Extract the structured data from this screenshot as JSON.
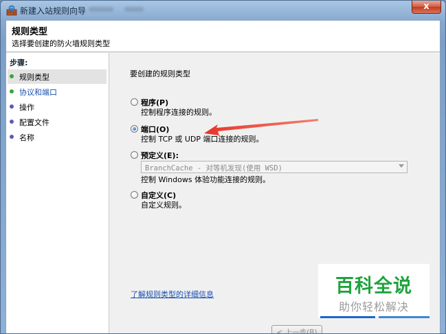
{
  "window": {
    "title": "新建入站规则向导",
    "close_symbol": "x"
  },
  "header": {
    "title": "规则类型",
    "subtitle": "选择要创建的防火墙规则类型"
  },
  "sidebar": {
    "steps_label": "步骤:",
    "steps": [
      {
        "label": "规则类型",
        "color": "#3aa53a",
        "current": true
      },
      {
        "label": "协议和端口",
        "color": "#3aa53a",
        "current": false
      },
      {
        "label": "操作",
        "color": "#5a5ab8",
        "current": false
      },
      {
        "label": "配置文件",
        "color": "#5a5ab8",
        "current": false
      },
      {
        "label": "名称",
        "color": "#5a5ab8",
        "current": false
      }
    ]
  },
  "main": {
    "prompt": "要创建的规则类型",
    "options": [
      {
        "label": "程序(P)",
        "description": "控制程序连接的规则。",
        "checked": false
      },
      {
        "label": "端口(O)",
        "description": "控制 TCP 或 UDP 端口连接的规则。",
        "checked": true
      },
      {
        "label": "预定义(E):",
        "description": "控制 Windows 体验功能连接的规则。",
        "checked": false
      },
      {
        "label": "自定义(C)",
        "description": "自定义规则。",
        "checked": false
      }
    ],
    "preset_value": "BranchCache - 对等机发现(使用 WSD)",
    "learn_more_link": "了解规则类型的详细信息"
  },
  "footer": {
    "back_label": "< 上一步(B)"
  },
  "watermark": {
    "logo": "百科全说",
    "tagline": "助你轻松解决"
  },
  "colors": {
    "arrow": "#e8352a",
    "link": "#1a4fb0",
    "watermark_green": "#1ea33d"
  }
}
